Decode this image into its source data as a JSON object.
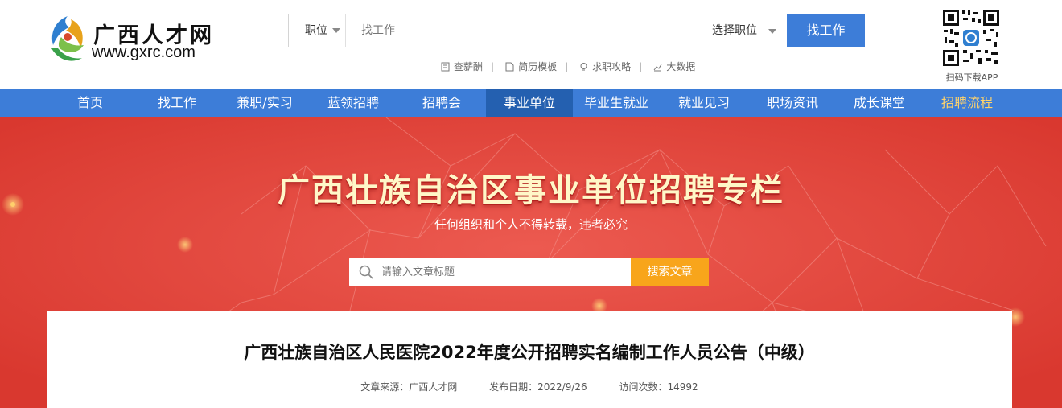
{
  "brand": {
    "name": "广西人才网",
    "url": "www.gxrc.com",
    "colors": {
      "primary": "#3d7dd8",
      "nav_active": "#2460b0",
      "banner": "#e0433d",
      "search_btn": "#f8a51b",
      "nav_highlight": "#ffd36b"
    }
  },
  "search": {
    "type_label": "职位",
    "keyword_placeholder": "找工作",
    "position_select": "选择职位",
    "button": "找工作"
  },
  "quick_links": [
    {
      "icon": "salary-icon",
      "label": "查薪酬"
    },
    {
      "icon": "resume-icon",
      "label": "简历模板"
    },
    {
      "icon": "tips-icon",
      "label": "求职攻略"
    },
    {
      "icon": "chart-icon",
      "label": "大数据"
    }
  ],
  "app": {
    "caption": "扫码下载APP"
  },
  "nav": {
    "items": [
      {
        "label": "首页"
      },
      {
        "label": "找工作"
      },
      {
        "label": "兼职/实习"
      },
      {
        "label": "蓝领招聘"
      },
      {
        "label": "招聘会"
      },
      {
        "label": "事业单位"
      },
      {
        "label": "毕业生就业"
      },
      {
        "label": "就业见习"
      },
      {
        "label": "职场资讯"
      },
      {
        "label": "成长课堂"
      },
      {
        "label": "招聘流程"
      }
    ],
    "active": "事业单位",
    "highlighted": "招聘流程"
  },
  "banner": {
    "title": "广西壮族自治区事业单位招聘专栏",
    "subtitle": "任何组织和个人不得转载，违者必究",
    "search_placeholder": "请输入文章标题",
    "search_button": "搜索文章"
  },
  "article": {
    "title": "广西壮族自治区人民医院2022年度公开招聘实名编制工作人员公告（中级）",
    "source": "文章来源：广西人才网",
    "date": "发布日期：2022/9/26",
    "visits": "访问次数：14992"
  }
}
